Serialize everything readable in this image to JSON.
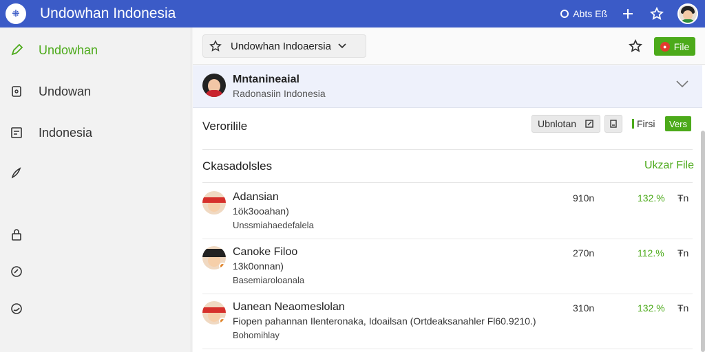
{
  "app": {
    "title": "Undowhan Indonesia",
    "logo_text": "⁜"
  },
  "topbar": {
    "account_text": "Abts Eß",
    "plus_icon": "plus-icon",
    "star_icon": "star-icon"
  },
  "sidebar": {
    "items": [
      {
        "label": "Undowhan",
        "icon": "edit-icon",
        "active": true
      },
      {
        "label": "Undowan",
        "icon": "document-icon",
        "active": false
      },
      {
        "label": "Indonesia",
        "icon": "list-icon",
        "active": false
      },
      {
        "label": "",
        "icon": "pen-icon",
        "active": false
      },
      {
        "label": "",
        "icon": "lock-icon",
        "active": false
      },
      {
        "label": "",
        "icon": "chat-icon",
        "active": false
      },
      {
        "label": "",
        "icon": "chat-alt-icon",
        "active": false
      }
    ]
  },
  "toolbar": {
    "breadcrumb": "Undowhan Indoaersia",
    "file_label": "File"
  },
  "profile": {
    "name": "Mntanineaial",
    "subtitle": "Radonasiin Indonesia"
  },
  "section_versions": {
    "title": "Verorilile",
    "button1_label": "Ubnlotan",
    "first_label": "Firsi",
    "vers_label": "Vers"
  },
  "section_files": {
    "title": "Ckasadolsles",
    "action_label": "Ukzar File"
  },
  "rows": [
    {
      "name": "Adansian",
      "line2": "1ök3ooahan)",
      "line3": "Unssmiahaedefalela",
      "size": "910n",
      "pct": "132.%",
      "unit": "Ŧn"
    },
    {
      "name": "Canoke Filoo",
      "line2": "13k0onnan)",
      "line3": "Basemiaroloanala",
      "size": "270n",
      "pct": "112.%",
      "unit": "Ŧn"
    },
    {
      "name": "Uanean Neaomeslolan",
      "line2": "Fiopen pahannan Ilenteronaka, Idoailsan (Ortdeaksanahler Fl60.9210.)",
      "line3": "Bohomihlay",
      "size": "310n",
      "pct": "132.%",
      "unit": "Ŧn"
    }
  ],
  "colors": {
    "topbar": "#3b5bc7",
    "accent_green": "#4caa1a",
    "profile_bg": "#eef1fb"
  }
}
